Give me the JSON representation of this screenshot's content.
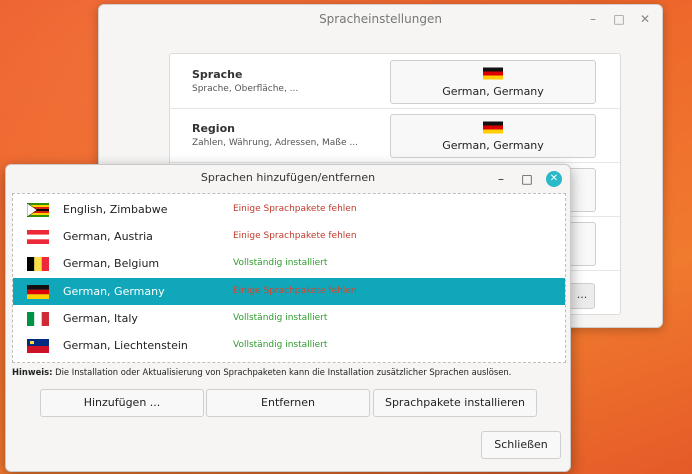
{
  "back_window": {
    "title": "Spracheinstellungen",
    "rows": [
      {
        "label": "Sprache",
        "desc": "Sprache, Oberfläche, ...",
        "value": "German, Germany"
      },
      {
        "label": "Region",
        "desc": "Zahlen, Währung, Adressen, Maße ...",
        "value": "German, Germany"
      }
    ],
    "more_button": "..."
  },
  "dialog": {
    "title": "Sprachen hinzufügen/entfernen",
    "languages": [
      {
        "name": "English, Zimbabwe",
        "status": "Einige Sprachpakete fehlen",
        "status_color": "#c0392b",
        "flag": "zimbabwe-flag-icon"
      },
      {
        "name": "German, Austria",
        "status": "Einige Sprachpakete fehlen",
        "status_color": "#c0392b",
        "flag": "austria-flag-icon"
      },
      {
        "name": "German, Belgium",
        "status": "Vollständig installiert",
        "status_color": "#2e9a2e",
        "flag": "belgium-flag-icon"
      },
      {
        "name": "German, Germany",
        "status": "Einige Sprachpakete fehlen",
        "status_color": "#c0392b",
        "flag": "germany-flag-icon",
        "selected": true
      },
      {
        "name": "German, Italy",
        "status": "Vollständig installiert",
        "status_color": "#2e9a2e",
        "flag": "italy-flag-icon"
      },
      {
        "name": "German, Liechtenstein",
        "status": "Vollständig installiert",
        "status_color": "#2e9a2e",
        "flag": "liechtenstein-flag-icon"
      }
    ],
    "hint_bold": "Hinweis:",
    "hint_text": " Die Installation oder Aktualisierung von Sprachpaketen kann die Installation zusätzlicher Sprachen auslösen.",
    "buttons": {
      "add": "Hinzufügen ...",
      "remove": "Entfernen",
      "install": "Sprachpakete installieren",
      "close": "Schließen"
    }
  },
  "colors": {
    "accent": "#0fa7b9",
    "close_button": "#2bb8c8",
    "background": "#ee6a2c"
  }
}
